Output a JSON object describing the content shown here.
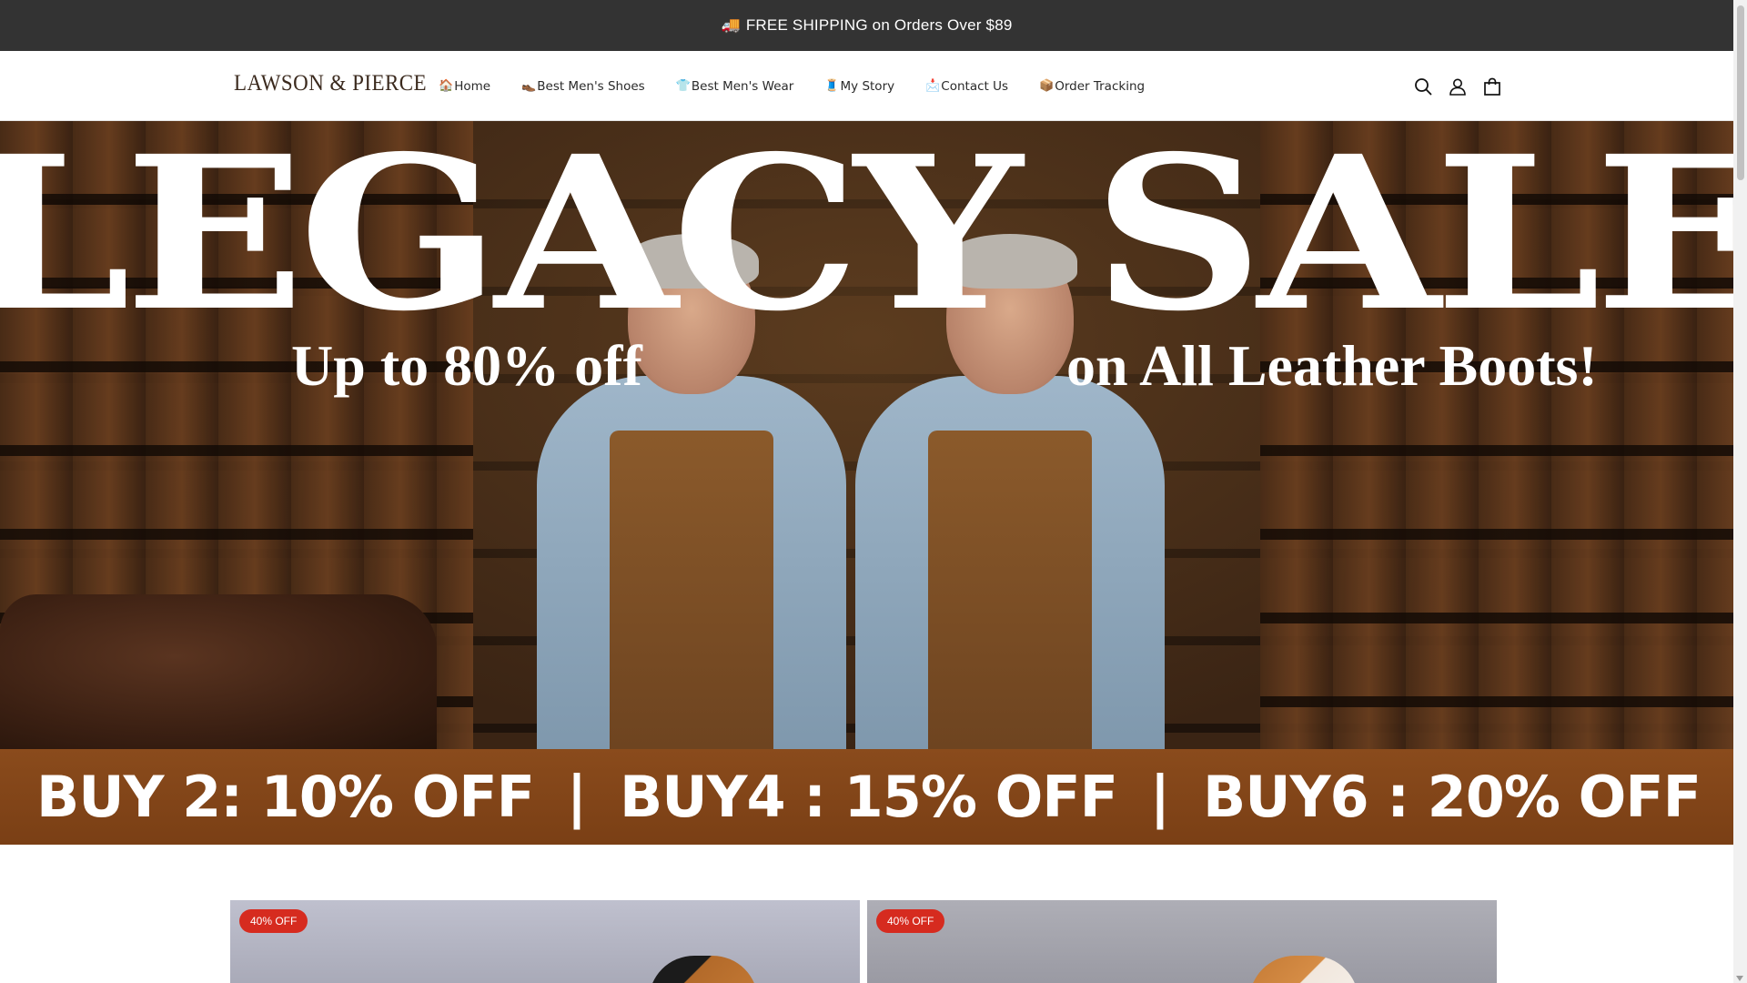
{
  "announcement": {
    "emoji": "🚚",
    "text": "FREE SHIPPING on Orders Over $89"
  },
  "header": {
    "logo": "LAWSON & PIERCE",
    "nav": [
      {
        "icon": "🏠",
        "label": "Home"
      },
      {
        "icon": "👞",
        "label": "Best Men's Shoes"
      },
      {
        "icon": "👕",
        "label": "Best Men's Wear"
      },
      {
        "icon": "🧵",
        "label": "My Story"
      },
      {
        "icon": "📩",
        "label": "Contact Us"
      },
      {
        "icon": "📦",
        "label": "Order Tracking"
      }
    ],
    "icons": [
      "search-icon",
      "account-icon",
      "cart-icon"
    ]
  },
  "hero": {
    "title": "LEGACY SALE",
    "subtitle_left": "Up to 80% off",
    "subtitle_right": "on All Leather Boots!",
    "offers": [
      "BUY 2: 10% OFF",
      "BUY4 : 15% OFF",
      "BUY6 : 20% OFF"
    ],
    "separator": "|"
  },
  "products": [
    {
      "badge": "40% OFF"
    },
    {
      "badge": "40% OFF"
    }
  ],
  "colors": {
    "announcement_bg": "#333333",
    "strip_bg": "#8a4b1c",
    "badge_bg": "#d62b1f"
  }
}
